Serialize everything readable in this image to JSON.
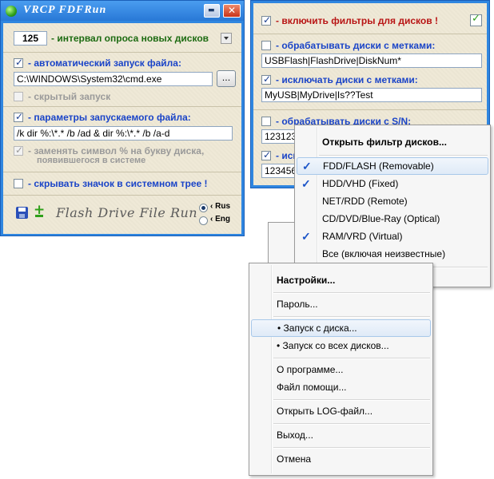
{
  "main_window": {
    "title": "VRCP  FDFRun",
    "minimize_glyph": "▬",
    "close_glyph": "✕",
    "interval_value": "125",
    "interval_label": "- интервал опроса новых дисков",
    "autorun_label": "- автоматический запуск файла:",
    "autorun_path": "C:\\WINDOWS\\System32\\cmd.exe",
    "browse_label": "...",
    "hidden_label": "- скрытый запуск",
    "params_label": "- параметры запускаемого файла:",
    "params_value": "/k dir %:\\*.* /b /ad & dir %:\\*.* /b /a-d",
    "replace_label": "- заменять символ  %  на букву диска,",
    "replace_label2": "появившегося в системе",
    "tray_label": "- скрывать значок в системном трее !",
    "logo_text": "Flash Drive File Run",
    "lang_rus": "‹ Rus",
    "lang_eng": "‹ Eng"
  },
  "filter_window": {
    "enable_label": "- включить фильтры для дисков !",
    "labels_proc": "- обрабатывать диски с метками:",
    "labels_proc_value": "USBFlash|FlashDrive|DiskNum*",
    "labels_excl": "- исключать диски с метками:",
    "labels_excl_value": "MyUSB|MyDrive|Is??Test",
    "sn_proc": "- обрабатывать диски с S/N:",
    "sn_proc_value": "123123",
    "sn_excl": "- иск",
    "sn_excl_value": "123456"
  },
  "filter_menu": {
    "header": "Открыть фильтр дисков...",
    "items": [
      {
        "label": "FDD/FLASH  (Removable)",
        "checked": true
      },
      {
        "label": "HDD/VHD  (Fixed)",
        "checked": true
      },
      {
        "label": "NET/RDD  (Remote)",
        "checked": false
      },
      {
        "label": "CD/DVD/Blue-Ray  (Optical)",
        "checked": false
      },
      {
        "label": "RAM/VRD  (Virtual)",
        "checked": true
      },
      {
        "label": "Все  (включая неизвестные)",
        "checked": false
      }
    ]
  },
  "context_menu": {
    "settings": "Настройки...",
    "password": "Пароль...",
    "run_from_disk": "• Запуск с диска...",
    "run_from_all": "• Запуск со всех дисков...",
    "about": "О программе...",
    "help": "Файл помощи...",
    "open_log": "Открыть LOG-файл...",
    "exit": "Выход...",
    "cancel": "Отмена"
  },
  "colors": {
    "title_bar": "#2f86e0",
    "panel": "#efe9d6",
    "accent_blue": "#1a44c8",
    "accent_green": "#1d6b12",
    "accent_red": "#b81414"
  }
}
